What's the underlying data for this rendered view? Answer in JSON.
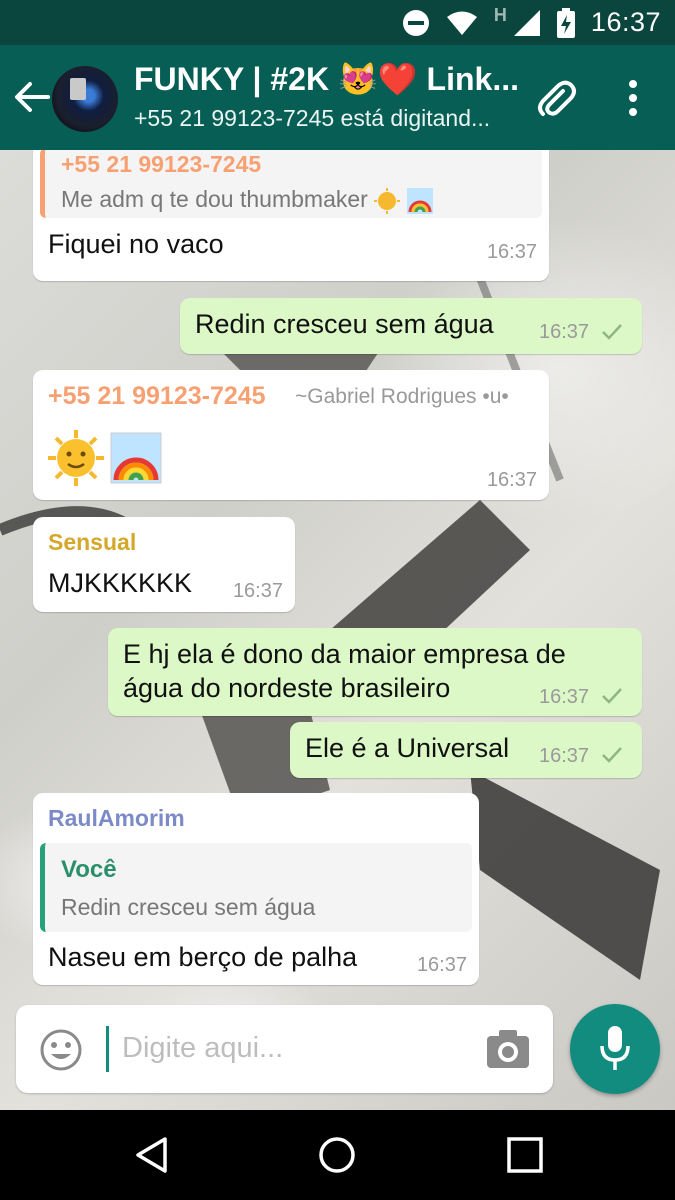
{
  "status_bar": {
    "time": "16:37",
    "network": "H"
  },
  "header": {
    "title": "FUNKY | #2K 😻❤️ Link...",
    "subtitle": "+55 21 99123-7245 está digitand..."
  },
  "colors": {
    "header": "#075e54",
    "status_bar": "#0b463e",
    "outgoing_bubble": "#dcf8c6",
    "accent": "#128c7e",
    "quote_bar": "#27a17a",
    "sender_phone": "#f7a072",
    "sender_sensual": "#d4a82a",
    "sender_raul": "#7c8bc8",
    "quote_voce": "#2b8f6b"
  },
  "messages": [
    {
      "direction": "in",
      "quote_sender": "+55 21 99123-7245",
      "quote_text": "Me adm q te dou thumbmaker",
      "text": "Fiquei no vaco",
      "time": "16:37"
    },
    {
      "direction": "out",
      "text": "Redin cresceu sem água",
      "time": "16:37",
      "status": "sent"
    },
    {
      "direction": "in",
      "sender": "+55 21 99123-7245",
      "sender_name": "~Gabriel Rodrigues •u•",
      "emojis": [
        "sun-with-face",
        "rainbow"
      ],
      "time": "16:37"
    },
    {
      "direction": "in",
      "sender": "Sensual",
      "text": "MJKKKKKK",
      "time": "16:37"
    },
    {
      "direction": "out",
      "text_line1": "E hj ela é dono da maior empresa de",
      "text_line2": "água do nordeste brasileiro",
      "time": "16:37",
      "status": "sent"
    },
    {
      "direction": "out",
      "text": "Ele é a Universal",
      "time": "16:37",
      "status": "sent"
    },
    {
      "direction": "in",
      "sender": "RaulAmorim",
      "quote_sender": "Você",
      "quote_text": "Redin cresceu sem água",
      "text": "Naseu em berço de palha",
      "time": "16:37"
    }
  ],
  "composer": {
    "placeholder": "Digite aqui..."
  }
}
